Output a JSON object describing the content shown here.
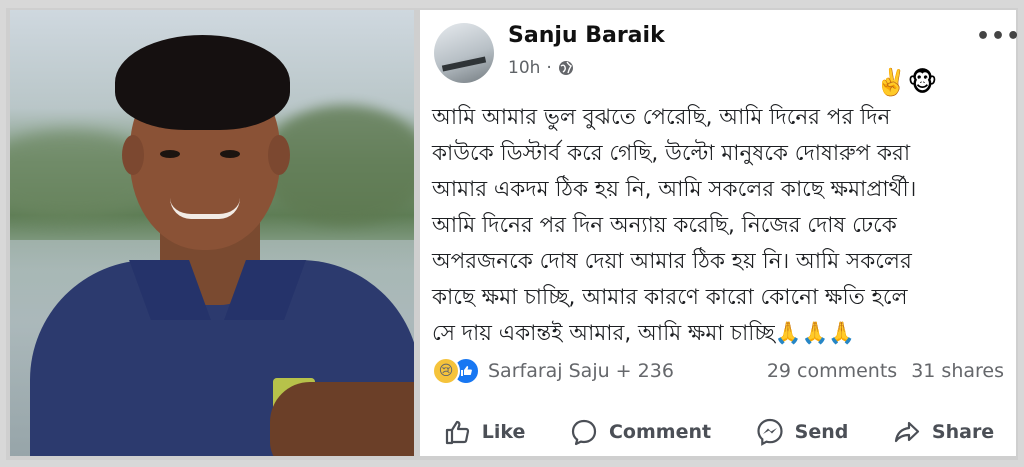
{
  "post": {
    "author": "Sanju Baraik",
    "time": "10h",
    "separator": "·",
    "header_emojis": "✌️🐵",
    "body": "আমি আমার ভুল বুঝতে পেরেছি, আমি দিনের পর দিন\nকাউকে ডিস্টার্ব করে গেছি, উল্টো মানুষকে দোষারুপ করা\nআমার একদম ঠিক হয় নি, আমি সকলের কাছে ক্ষমাপ্রার্থী।\nআমি দিনের পর দিন অন্যায় করেছি, নিজের দোষ ঢেকে\nঅপরজনকে দোষ দেয়া আমার ঠিক হয় নি। আমি সকলের\nকাছে ক্ষমা চাচ্ছি, আমার কারণে কারো কোনো ক্ষতি হলে\nসে দায় একান্তই আমার, আমি ক্ষমা চাচ্ছি🙏🙏🙏"
  },
  "stats": {
    "reactors": "Sarfaraj Saju + 236",
    "comments": "29 comments",
    "shares": "31 shares"
  },
  "actions": {
    "like": "Like",
    "comment": "Comment",
    "send": "Send",
    "share": "Share"
  },
  "colors": {
    "brand_blue": "#1877f2",
    "text": "#1c1e21",
    "secondary": "#65676b"
  }
}
